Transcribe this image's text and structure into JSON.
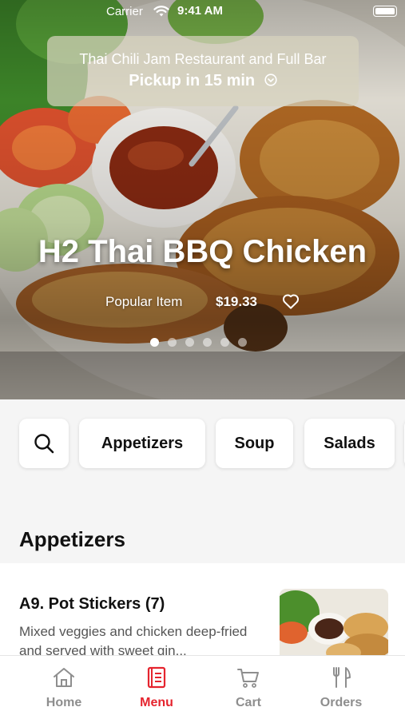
{
  "status_bar": {
    "carrier": "Carrier",
    "time": "9:41 AM"
  },
  "pickup": {
    "restaurant": "Thai Chili Jam Restaurant and Full Bar",
    "label": "Pickup in 15 min"
  },
  "hero": {
    "title": "H2 Thai BBQ Chicken",
    "badge": "Popular Item",
    "price": "$19.33",
    "carousel_dots": 6,
    "active_dot": 0
  },
  "categories": [
    {
      "label": "Appetizers"
    },
    {
      "label": "Soup"
    },
    {
      "label": "Salads"
    }
  ],
  "section": {
    "title": "Appetizers"
  },
  "items": [
    {
      "name": "A9. Pot Stickers (7)",
      "description": "Mixed veggies and chicken deep-fried and served with sweet gin..."
    }
  ],
  "tabs": [
    {
      "label": "Home",
      "icon": "home-icon"
    },
    {
      "label": "Menu",
      "icon": "menu-book-icon"
    },
    {
      "label": "Cart",
      "icon": "cart-icon"
    },
    {
      "label": "Orders",
      "icon": "fork-knife-icon"
    }
  ],
  "colors": {
    "accent": "#e5242e",
    "tab_inactive": "#8e8e8e"
  }
}
